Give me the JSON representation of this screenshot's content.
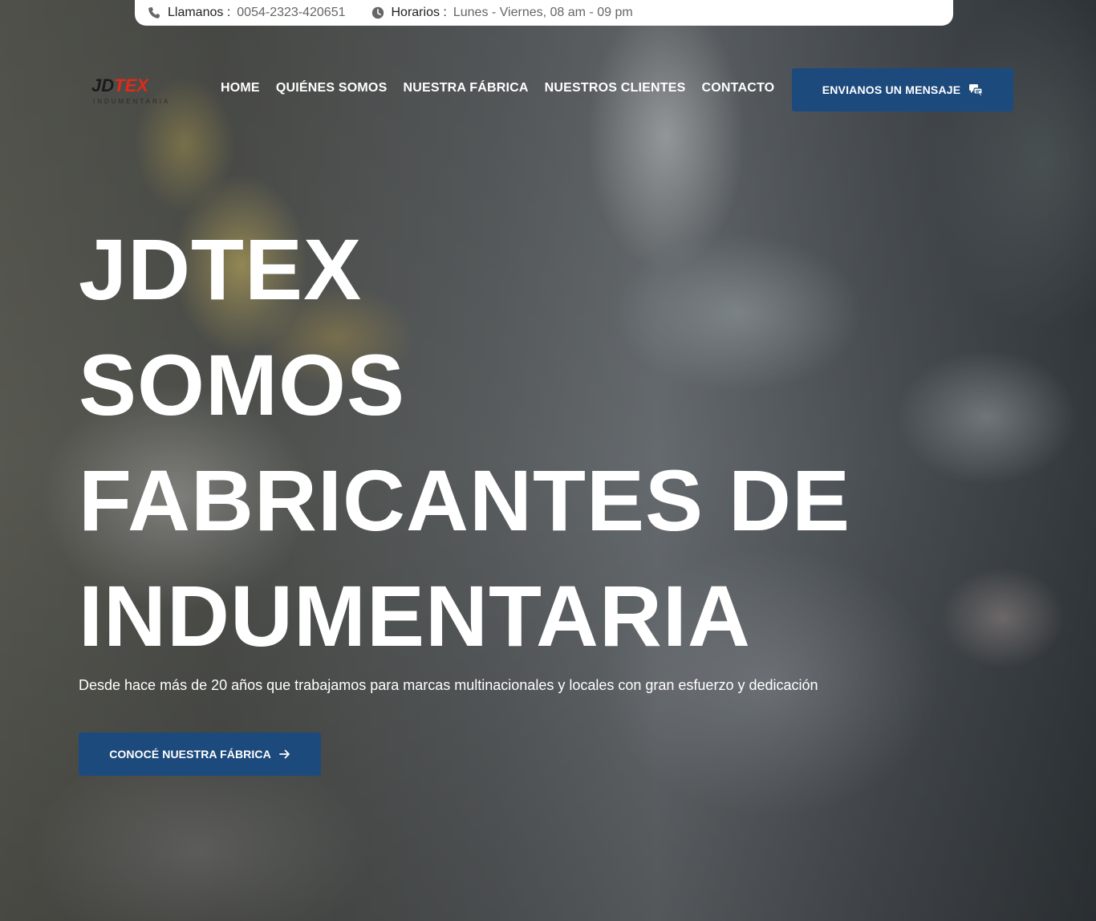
{
  "topbar": {
    "phone_label": "Llamanos :",
    "phone_value": "0054-2323-420651",
    "hours_label": "Horarios :",
    "hours_value": "Lunes - Viernes, 08 am - 09 pm",
    "phone_icon": "phone-icon",
    "clock_icon": "clock-icon"
  },
  "header": {
    "logo_mark_left": "JD",
    "logo_mark_right": "TEX",
    "logo_sub": "INDUMENTARIA",
    "nav": [
      {
        "label": "HOME"
      },
      {
        "label": "QUIÉNES SOMOS"
      },
      {
        "label": "NUESTRA FÁBRICA"
      },
      {
        "label": "NUESTROS CLIENTES"
      },
      {
        "label": "CONTACTO"
      }
    ],
    "cta_label": "ENVIANOS UN MENSAJE",
    "cta_icon": "message-icon"
  },
  "hero": {
    "headline_lines": [
      "JDTEX",
      "SOMOS",
      "FABRICANTES DE",
      "INDUMENTARIA"
    ],
    "subtitle": "Desde hace más de 20 años que trabajamos para marcas multinacionales y locales con gran esfuerzo y dedicación",
    "cta_label": "CONOCÉ NUESTRA FÁBRICA",
    "cta_icon": "arrow-right-icon"
  },
  "colors": {
    "accent": "#1d4a7d",
    "logo_red": "#e02a1b"
  }
}
